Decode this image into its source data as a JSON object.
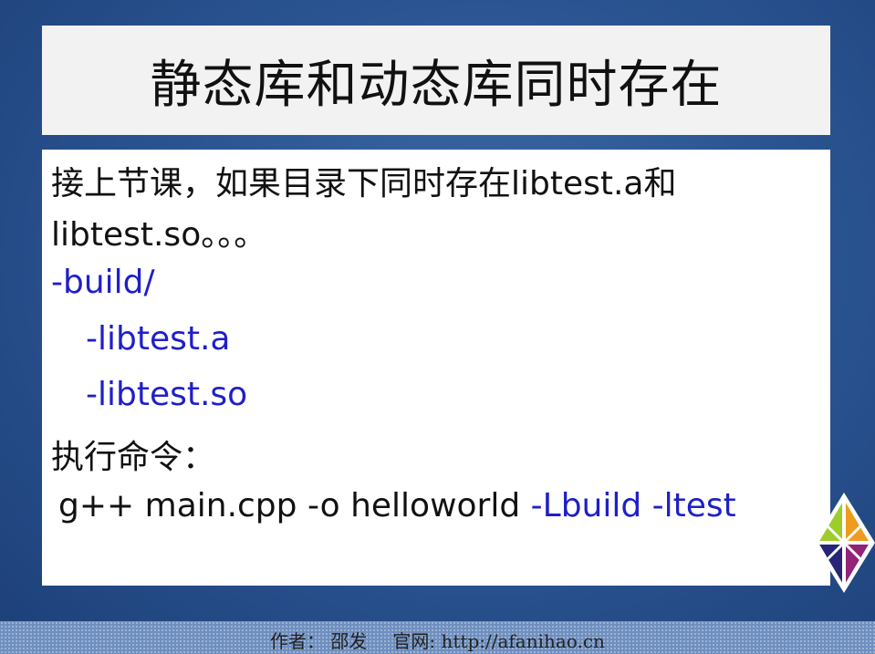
{
  "slide": {
    "title": "静态库和动态库同时存在",
    "lines": [
      "接上节课，如果目录下同时存在libtest.a和",
      "libtest.so。。。",
      "-build/",
      "-libtest.a",
      "-libtest.so",
      "执行命令：",
      "g++ main.cpp -o helloworld",
      "-Lbuild -ltest"
    ]
  },
  "footer": {
    "author": "作者：  邵发",
    "site": "官网: http://afanihao.cn"
  },
  "colors": {
    "background": "#2b5693",
    "link_blue": "#1f1fc8",
    "title_box": "#f2f2f2"
  },
  "logo": {
    "icon": "centos-logo-icon"
  }
}
